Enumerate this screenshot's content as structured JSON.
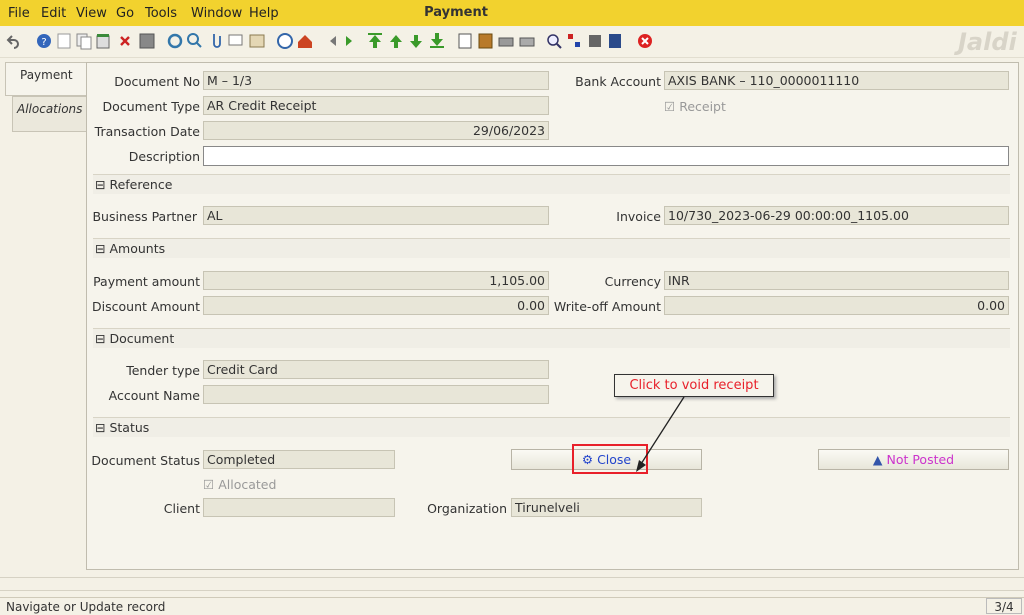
{
  "menu": {
    "file": "File",
    "edit": "Edit",
    "view": "View",
    "go": "Go",
    "tools": "Tools",
    "window": "Window",
    "help": "Help"
  },
  "window_title": "Payment",
  "watermark": "Jaldi",
  "tabs": [
    "Payment",
    "Allocations"
  ],
  "fields": {
    "document_no_label": "Document No",
    "document_no": "M – 1/3",
    "document_type_label": "Document Type",
    "document_type": "AR Credit Receipt",
    "transaction_date_label": "Transaction Date",
    "transaction_date": "29/06/2023",
    "description_label": "Description",
    "description": "",
    "bank_account_label": "Bank Account",
    "bank_account": "AXIS BANK – 110_0000011110",
    "receipt_label": "Receipt",
    "business_partner_label": "Business Partner",
    "business_partner": "AL",
    "invoice_label": "Invoice",
    "invoice": "10/730_2023-06-29 00:00:00_1105.00",
    "payment_amount_label": "Payment amount",
    "payment_amount": "1,105.00",
    "currency_label": "Currency",
    "currency": "INR",
    "discount_amount_label": "Discount Amount",
    "discount_amount": "0.00",
    "writeoff_amount_label": "Write-off Amount",
    "writeoff_amount": "0.00",
    "tender_type_label": "Tender type",
    "tender_type": "Credit Card",
    "account_name_label": "Account Name",
    "account_name": "",
    "document_status_label": "Document Status",
    "document_status": "Completed",
    "allocated_label": "Allocated",
    "client_label": "Client",
    "client": "",
    "organization_label": "Organization",
    "organization": "Tirunelveli"
  },
  "sections": {
    "reference": "Reference",
    "amounts": "Amounts",
    "document": "Document",
    "status": "Status"
  },
  "buttons": {
    "close": "Close",
    "not_posted": "Not Posted"
  },
  "callout": "Click to void receipt",
  "statusbar": {
    "message": "Navigate or Update record",
    "record": "3/4"
  },
  "colors": {
    "menubar": "#f2d22e",
    "not_posted": "#cc33cc",
    "close_text": "#2244cc",
    "callout_text": "#e8202a",
    "callout_border": "#e8202a"
  },
  "toolbar_icons": [
    "undo-icon",
    "help-icon",
    "new-icon",
    "copy-icon",
    "delete-record-icon",
    "delete-icon",
    "save-icon",
    "refresh-icon",
    "find-icon",
    "attachment-icon",
    "chat-icon",
    "grid-toggle-icon",
    "history-icon",
    "home-icon",
    "back-icon",
    "forward-icon",
    "first-record-icon",
    "previous-record-icon",
    "next-record-icon",
    "last-record-icon",
    "report-icon",
    "archive-icon",
    "print-icon",
    "print-preview-icon",
    "zoom-across-icon",
    "workflow-icon",
    "product-info-icon",
    "request-icon",
    "exit-icon"
  ]
}
